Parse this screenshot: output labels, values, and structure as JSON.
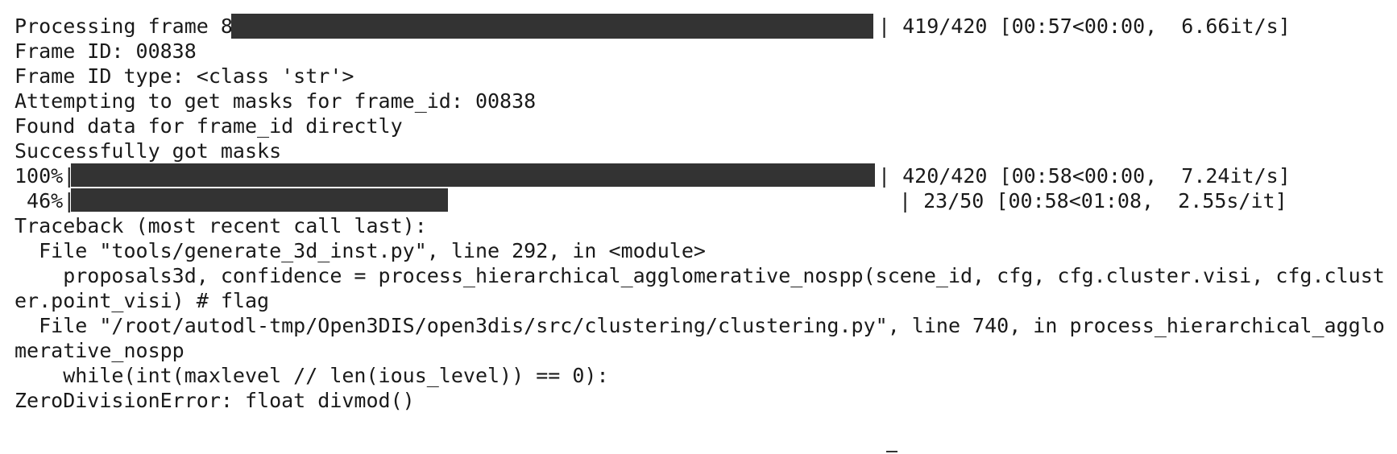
{
  "colors": {
    "background": "#ffffff",
    "text": "#1a1a1a",
    "bar_fill": "#333333"
  },
  "progress": [
    {
      "prefix": "Processing frame 838",
      "fraction": 0.9976,
      "suffix": "| 419/420 [00:57<00:00,  6.66it/s]"
    },
    {
      "prefix": "100%|",
      "fraction": 1.0,
      "suffix": "| 420/420 [00:58<00:00,  7.24it/s]"
    },
    {
      "prefix": " 46%|",
      "fraction": 0.46,
      "suffix": "| 23/50 [00:58<01:08,  2.55s/it]"
    }
  ],
  "log_lines": [
    "Frame ID: 00838",
    "Frame ID type: <class 'str'>",
    "Attempting to get masks for frame_id: 00838",
    "Found data for frame_id directly",
    "Successfully got masks"
  ],
  "traceback": {
    "header": "Traceback (most recent call last):",
    "frames": [
      "  File \"tools/generate_3d_inst.py\", line 292, in <module>",
      "    proposals3d, confidence = process_hierarchical_agglomerative_nospp(scene_id, cfg, cfg.cluster.visi, cfg.clust",
      "er.point_visi) # flag",
      "  File \"/root/autodl-tmp/Open3DIS/open3dis/src/clustering/clustering.py\", line 740, in process_hierarchical_agglo",
      "merative_nospp",
      "    while(int(maxlevel // len(ious_level)) == 0):"
    ],
    "error": "ZeroDivisionError: float divmod()"
  }
}
